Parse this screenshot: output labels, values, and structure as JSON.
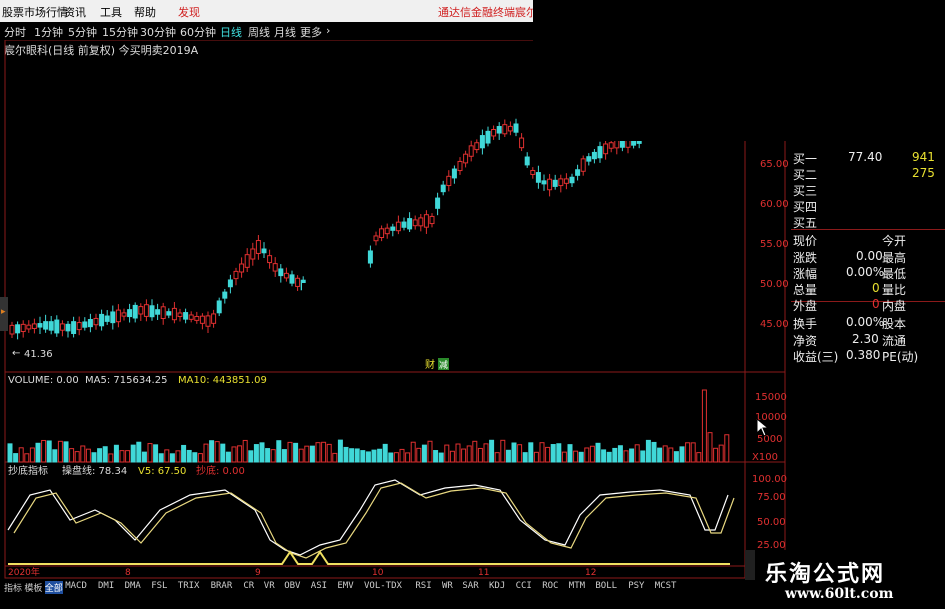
{
  "menu": {
    "items": [
      "股票市场行情",
      "资讯",
      "工具",
      "帮助"
    ],
    "discover": "发现",
    "broker": "通达信金融终端",
    "broker2": "宸尔"
  },
  "periods": [
    "分时",
    "1分钟",
    "5分钟",
    "15分钟",
    "30分钟",
    "60分钟",
    "日线",
    "周线",
    "月线",
    "更多"
  ],
  "active_period": "日线",
  "chart_title": "宸尔眼科(日线 前复权) 今买明卖2019A",
  "price_axis": [
    "65.00",
    "60.00",
    "55.00",
    "50.00",
    "45.00"
  ],
  "low_marker": "41.36",
  "cai_label": "财",
  "jian_label": "减",
  "volume_header": {
    "label": "VOLUME: 0.00",
    "ma5": "MA5: 715634.25",
    "ma10": "MA10: 443851.09"
  },
  "volume_axis": [
    "15000",
    "10000",
    "5000",
    "X100"
  ],
  "indicator_header": {
    "name": "抄底指标",
    "op": "操盘线: 78.34",
    "v5": "V5: 67.50",
    "chao": "抄底: 0.00"
  },
  "indicator_axis": [
    "100.00",
    "75.00",
    "50.00",
    "25.00"
  ],
  "date_labels": [
    "2020年",
    "8",
    "9",
    "10",
    "11",
    "12"
  ],
  "bottom_tabs": [
    "指标",
    "模板",
    "全部",
    "MACD",
    "DMI",
    "DMA",
    "FSL",
    "TRIX",
    "BRAR",
    "CR",
    "VR",
    "OBV",
    "ASI",
    "EMV",
    "VOL-TDX",
    "RSI",
    "WR",
    "SAR",
    "KDJ",
    "CCI",
    "ROC",
    "MTM",
    "BOLL",
    "PSY",
    "MCST"
  ],
  "quote": {
    "buy1_label": "买一",
    "buy1_price": "77.40",
    "buy1_vol": "941",
    "buy2_label": "买二",
    "buy2_vol": "275",
    "buy3_label": "买三",
    "buy4_label": "买四",
    "buy5_label": "买五",
    "now_label": "现价",
    "open_label": "今开",
    "chg_label": "涨跌",
    "chg_val": "0.00",
    "high_label": "最高",
    "pct_label": "涨幅",
    "pct_val": "0.00%",
    "low_label": "最低",
    "total_label": "总量",
    "total_val": "0",
    "ratio_label": "量比",
    "outer_label": "外盘",
    "outer_val": "0",
    "inner_label": "内盘",
    "turn_label": "换手",
    "turn_val": "0.00%",
    "share_label": "股本",
    "net_label": "净资",
    "net_val": "2.30",
    "flow_label": "流通",
    "eps_label": "收益(三)",
    "eps_val": "0.380",
    "pe_label": "PE(动)"
  },
  "watermark": {
    "title": "乐淘公式网",
    "url": "www.60lt.com"
  },
  "colors": {
    "up": "#e03030",
    "down": "#40d8d8",
    "frame": "#8b1a1a",
    "line1": "#ffffff",
    "line2": "#e8d880",
    "signal": "#f0e060"
  }
}
